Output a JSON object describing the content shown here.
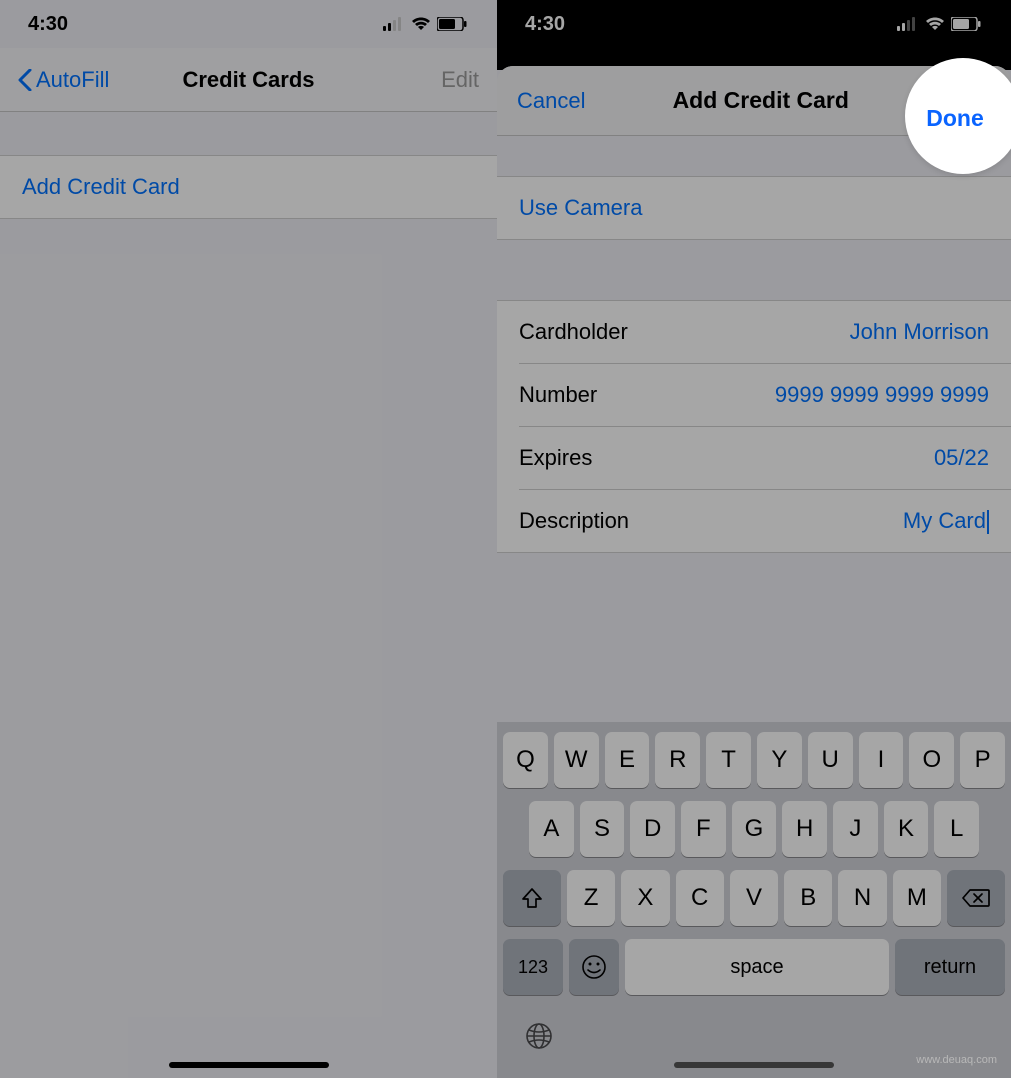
{
  "left": {
    "status_time": "4:30",
    "nav_back": "AutoFill",
    "nav_title": "Credit Cards",
    "nav_edit": "Edit",
    "add_card": "Add Credit Card"
  },
  "right": {
    "status_time": "4:30",
    "sheet": {
      "cancel": "Cancel",
      "title": "Add Credit Card",
      "done": "Done",
      "use_camera": "Use Camera",
      "fields": {
        "cardholder_label": "Cardholder",
        "cardholder_value": "John Morrison",
        "number_label": "Number",
        "number_value": "9999 9999 9999 9999",
        "expires_label": "Expires",
        "expires_value": "05/22",
        "description_label": "Description",
        "description_value": "My Card"
      }
    },
    "keyboard": {
      "row1": [
        "Q",
        "W",
        "E",
        "R",
        "T",
        "Y",
        "U",
        "I",
        "O",
        "P"
      ],
      "row2": [
        "A",
        "S",
        "D",
        "F",
        "G",
        "H",
        "J",
        "K",
        "L"
      ],
      "row3": [
        "Z",
        "X",
        "C",
        "V",
        "B",
        "N",
        "M"
      ],
      "numbers": "123",
      "space": "space",
      "return": "return"
    }
  },
  "watermark": "www.deuaq.com"
}
